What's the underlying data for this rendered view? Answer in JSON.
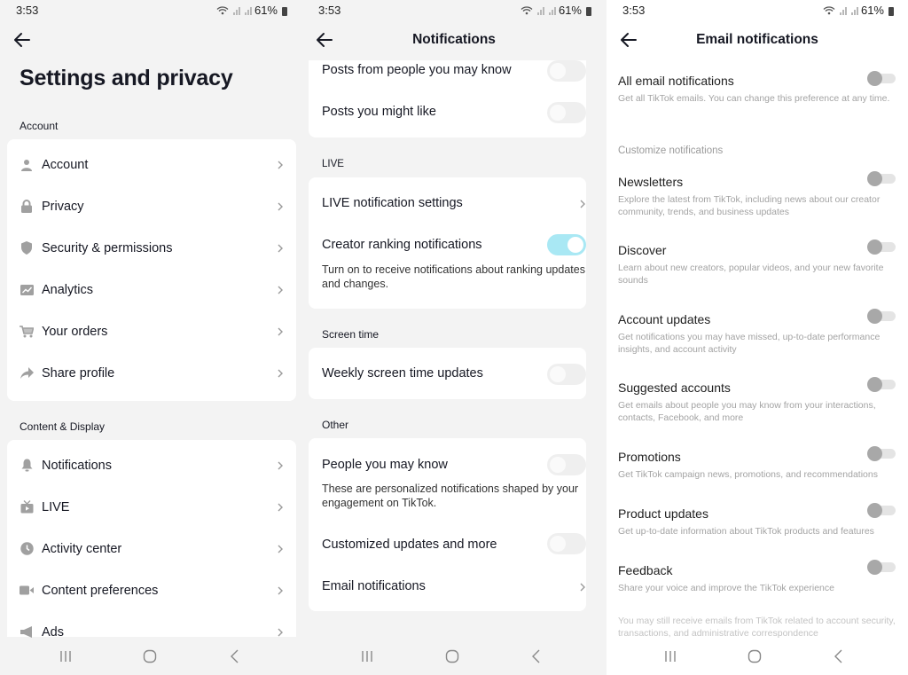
{
  "status_bar": {
    "time": "3:53",
    "battery": "61%"
  },
  "panel1": {
    "title": "Settings and privacy",
    "sections": [
      {
        "label": "Account",
        "items": [
          {
            "label": "Account",
            "icon": "person-icon"
          },
          {
            "label": "Privacy",
            "icon": "lock-icon"
          },
          {
            "label": "Security & permissions",
            "icon": "shield-icon"
          },
          {
            "label": "Analytics",
            "icon": "analytics-icon"
          },
          {
            "label": "Your orders",
            "icon": "cart-icon"
          },
          {
            "label": "Share profile",
            "icon": "share-icon"
          }
        ]
      },
      {
        "label": "Content & Display",
        "items": [
          {
            "label": "Notifications",
            "icon": "bell-icon"
          },
          {
            "label": "LIVE",
            "icon": "tv-icon"
          },
          {
            "label": "Activity center",
            "icon": "clock-icon"
          },
          {
            "label": "Content preferences",
            "icon": "video-camera-icon"
          },
          {
            "label": "Ads",
            "icon": "megaphone-icon"
          }
        ]
      }
    ]
  },
  "panel2": {
    "title": "Notifications",
    "top_items": [
      {
        "label": "Posts from people you may know",
        "toggle": false
      },
      {
        "label": "Posts you might like",
        "toggle": false
      }
    ],
    "live": {
      "label": "LIVE",
      "settings_label": "LIVE notification settings",
      "creator_ranking": {
        "label": "Creator ranking notifications",
        "description": "Turn on to receive notifications about ranking updates and changes.",
        "toggle": true
      }
    },
    "screen_time": {
      "label": "Screen time",
      "weekly_label": "Weekly screen time updates",
      "toggle": false
    },
    "other": {
      "label": "Other",
      "people": {
        "label": "People you may know",
        "description": "These are personalized notifications shaped by your engagement on TikTok.",
        "toggle": false
      },
      "customized": {
        "label": "Customized updates and more",
        "toggle": false
      },
      "email_label": "Email notifications"
    }
  },
  "panel3": {
    "title": "Email notifications",
    "all": {
      "label": "All email notifications",
      "description": "Get all TikTok emails. You can change this preference at any time.",
      "toggle": false
    },
    "customize_label": "Customize notifications",
    "items": [
      {
        "label": "Newsletters",
        "description": "Explore the latest from TikTok, including news about our creator community, trends, and business updates",
        "toggle": false
      },
      {
        "label": "Discover",
        "description": "Learn about new creators, popular videos, and your new favorite sounds",
        "toggle": false
      },
      {
        "label": "Account updates",
        "description": "Get notifications you may have missed, up-to-date performance insights, and account activity",
        "toggle": false
      },
      {
        "label": "Suggested accounts",
        "description": "Get emails about people you may know from your interactions, contacts, Facebook, and more",
        "toggle": false
      },
      {
        "label": "Promotions",
        "description": "Get TikTok campaign news, promotions, and recommendations",
        "toggle": false
      },
      {
        "label": "Product updates",
        "description": "Get up-to-date information about TikTok products and features",
        "toggle": false
      },
      {
        "label": "Feedback",
        "description": "Share your voice and improve the TikTok experience",
        "toggle": false
      }
    ],
    "footer": "You may still receive emails from TikTok related to account security, transactions, and administrative correspondence"
  },
  "colors": {
    "toggle_on": "#a9e8f4",
    "text": "#161823",
    "muted": "#a3a3a3"
  }
}
